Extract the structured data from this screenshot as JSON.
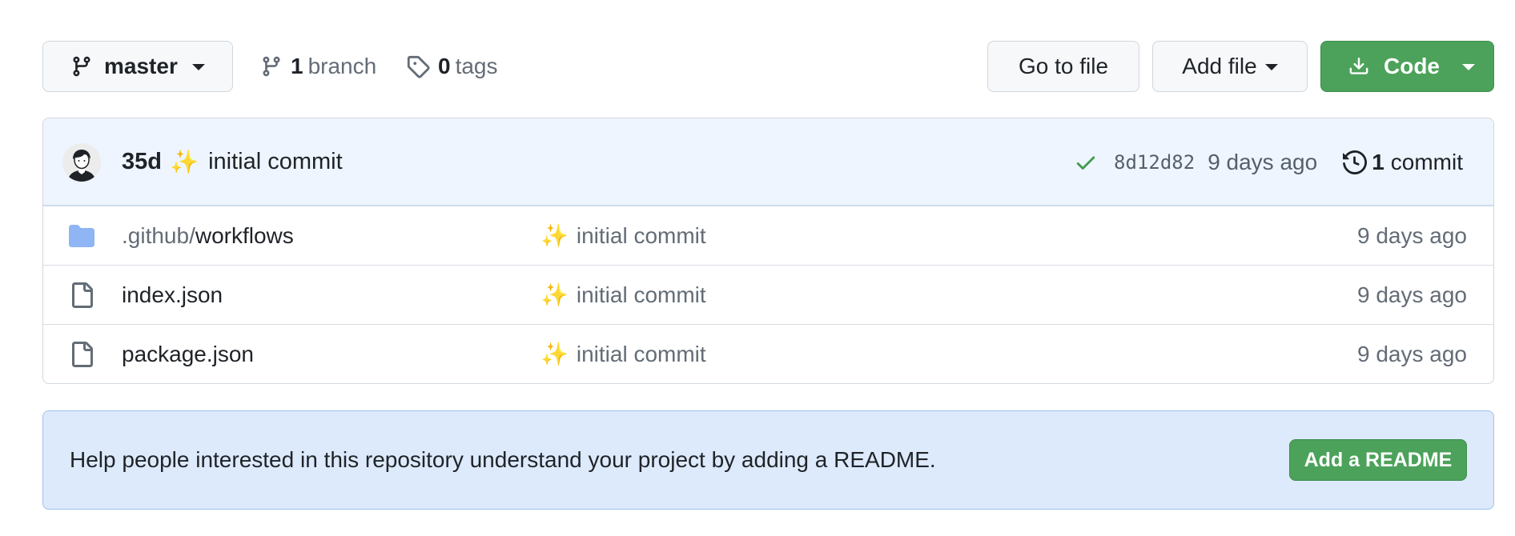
{
  "toolbar": {
    "branch_selector": {
      "label": "master"
    },
    "branches": {
      "count": "1",
      "label": "branch"
    },
    "tags": {
      "count": "0",
      "label": "tags"
    },
    "go_to_file_label": "Go to file",
    "add_file_label": "Add file",
    "code_label": "Code"
  },
  "latest_commit": {
    "author": "35d",
    "emoji": "✨",
    "message": "initial commit",
    "status": "success",
    "sha": "8d12d82",
    "age": "9 days ago",
    "history_count": "1",
    "history_label": "commit"
  },
  "files": [
    {
      "type": "directory",
      "name_prefix": ".github/",
      "name": "workflows",
      "commit_emoji": "✨",
      "commit_message": "initial commit",
      "age": "9 days ago"
    },
    {
      "type": "file",
      "name_prefix": "",
      "name": "index.json",
      "commit_emoji": "✨",
      "commit_message": "initial commit",
      "age": "9 days ago"
    },
    {
      "type": "file",
      "name_prefix": "",
      "name": "package.json",
      "commit_emoji": "✨",
      "commit_message": "initial commit",
      "age": "9 days ago"
    }
  ],
  "readme_banner": {
    "message": "Help people interested in this repository understand your project by adding a README.",
    "button_label": "Add a README"
  },
  "colors": {
    "primary_green": "#4ca25a",
    "commit_bar_bg": "#eef5fe",
    "banner_bg": "#ddeafc",
    "folder_blue": "#8fb5f5",
    "check_green": "#3f9a4f"
  },
  "icons": {
    "branch": "git-branch-icon",
    "tag": "tag-icon",
    "download": "download-icon",
    "check": "check-icon",
    "history": "history-icon",
    "folder": "folder-icon",
    "file": "file-icon"
  }
}
